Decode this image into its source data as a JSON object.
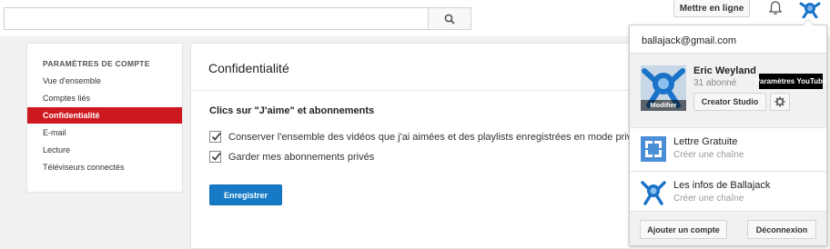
{
  "header": {
    "search_placeholder": "",
    "upload_label": "Mettre en ligne"
  },
  "nav": {
    "title": "PARAMÈTRES DE COMPTE",
    "items": [
      {
        "label": "Vue d'ensemble"
      },
      {
        "label": "Comptes liés"
      },
      {
        "label": "Confidentialité",
        "active": true
      },
      {
        "label": "E-mail"
      },
      {
        "label": "Lecture"
      },
      {
        "label": "Téléviseurs connectés"
      }
    ]
  },
  "main": {
    "title": "Confidentialité",
    "section_title": "Clics sur \"J'aime\" et abonnements",
    "checkboxes": [
      {
        "label": "Conserver l'ensemble des vidéos que j'ai aimées et des playlists enregistrées en mode privé",
        "checked": true
      },
      {
        "label": "Garder mes abonnements privés",
        "checked": true
      }
    ],
    "save_label": "Enregistrer"
  },
  "account_menu": {
    "email": "ballajack@gmail.com",
    "current": {
      "name": "Eric Weyland",
      "subscribers": "31 abonné",
      "modify_label": "Modifier",
      "creator_studio_label": "Creator Studio",
      "tooltip": "Paramètres YouTube"
    },
    "channels": [
      {
        "name": "Lettre Gratuite",
        "sub": "Créer une chaîne"
      },
      {
        "name": "Les infos de Ballajack",
        "sub": "Créer une chaîne"
      }
    ],
    "add_account_label": "Ajouter un compte",
    "logout_label": "Déconnexion"
  },
  "colors": {
    "accent_red": "#cc181e",
    "button_blue": "#167ac6",
    "avatar_blue": "#1a73c8"
  },
  "icons": [
    "search-icon",
    "bell-icon",
    "gear-icon",
    "checkmark-icon",
    "avatar-icon",
    "channel-icon"
  ]
}
